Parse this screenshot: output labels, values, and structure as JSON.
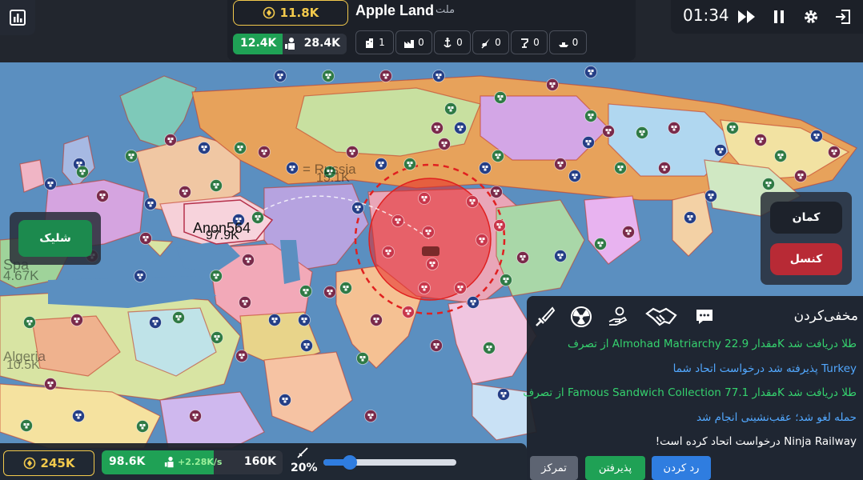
{
  "topbar": {
    "gold": "11.8K",
    "nation_name": "Apple Land",
    "nation_label": "ملت",
    "troops_available": "12.4K",
    "troops_max": "28.4K",
    "buildings": [
      {
        "icon": "city-icon",
        "count": "1"
      },
      {
        "icon": "factory-icon",
        "count": "0"
      },
      {
        "icon": "port-icon",
        "count": "0"
      },
      {
        "icon": "missile-silo-icon",
        "count": "0"
      },
      {
        "icon": "defense-post-icon",
        "count": "0"
      },
      {
        "icon": "warship-icon",
        "count": "0"
      }
    ]
  },
  "time": {
    "clock": "01:34"
  },
  "map_labels": {
    "russia_name": "Russia",
    "russia_value": "15.1K",
    "anon_name": "Anon564",
    "anon_value": "97.9K",
    "spain_name": "Spa",
    "spain_value": "4.67K",
    "algeria_name": "Algeria",
    "algeria_value": "10.5K"
  },
  "left_action": {
    "shoot_label": "شلیک"
  },
  "right_action": {
    "bow_label": "کمان",
    "cancel_label": "کنسل"
  },
  "events": {
    "hide_label": "مخفی‌کردن",
    "messages": [
      {
        "text": "طلا دریافت شد Kمقدار 22.9 Almohad Matriarchy از تصرف",
        "color": "#35d26e"
      },
      {
        "text": "Turkey پذیرفته شد درخواست اتحاد شما",
        "color": "#52a8ff"
      },
      {
        "text": "طلا دریافت شد Kمقدار 77.1 Famous Sandwich Collection از تصرف",
        "color": "#35d26e"
      },
      {
        "text": "حمله لغو شد؛ عقب‌نشینی انجام شد",
        "color": "#52a8ff"
      },
      {
        "text": "Ninja Railway درخواست اتحاد کرده است!",
        "color": "#ffffff"
      }
    ],
    "focus_label": "تمرکز",
    "accept_label": "پذیرفتن",
    "reject_label": "رد کردن"
  },
  "bottombar": {
    "gold": "245K",
    "troops": "98.6K",
    "troop_rate": "+2.28K/s",
    "troops_max": "160K",
    "attack_ratio": "20%",
    "attack_ratio_value": 0.2
  },
  "colors": {
    "ocean": "#5b8fc0",
    "accent_green": "#1fa155",
    "accent_blue": "#2f7de0",
    "cancel_red": "#c0303a",
    "gold": "#f2c94c"
  }
}
